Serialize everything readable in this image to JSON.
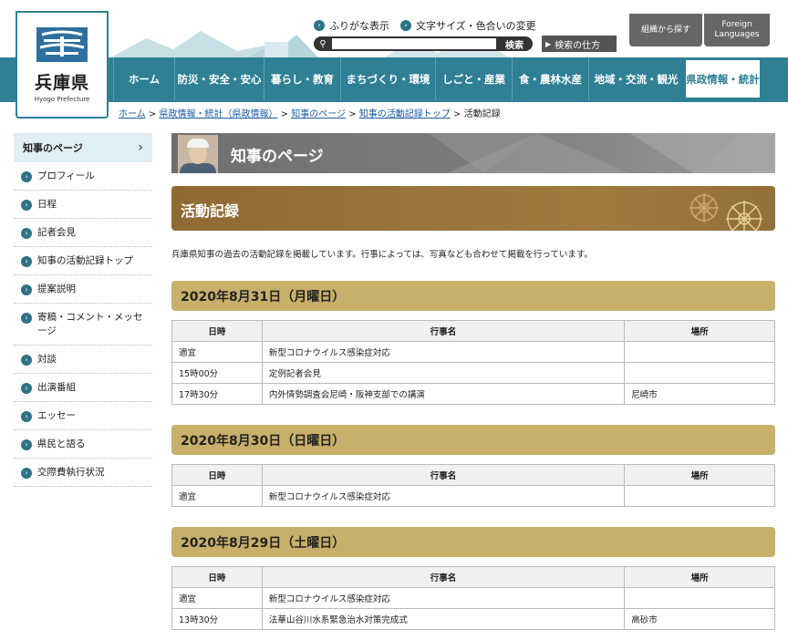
{
  "header": {
    "logo_title": "兵庫県",
    "logo_sub": "Hyogo Prefecture",
    "util_links": [
      "ふりがな表示",
      "文字サイズ・色合いの変更"
    ],
    "search": {
      "placeholder": "",
      "button": "検索"
    },
    "howto": "検索の仕方",
    "org_search": "組織から探す",
    "foreign": "Foreign Languages"
  },
  "nav": {
    "items": [
      "ホーム",
      "防災・安全・安心",
      "暮らし・教育",
      "まちづくり・環境",
      "しごと・産業",
      "食・農林水産",
      "地域・交流・観光",
      "県政情報・統計"
    ],
    "active_index": 7
  },
  "breadcrumb": [
    "ホーム",
    "県政情報・統計（県政情報）",
    "知事のページ",
    "知事の活動記録トップ",
    "活動記録"
  ],
  "sidebar": {
    "title": "知事のページ",
    "items": [
      "プロフィール",
      "日程",
      "記者会見",
      "知事の活動記録トップ",
      "提案説明",
      "寄稿・コメント・メッセージ",
      "対談",
      "出演番組",
      "エッセー",
      "県民と語る",
      "交際費執行状況"
    ]
  },
  "main": {
    "banner": "知事のページ",
    "title": "活動記録",
    "intro": "兵庫県知事の過去の活動記録を掲載しています。行事によっては、写真なども合わせて掲載を行っています。",
    "columns": [
      "日時",
      "行事名",
      "場所"
    ],
    "days": [
      {
        "date": "2020年8月31日（月曜日）",
        "rows": [
          [
            "適宜",
            "新型コロナウイルス感染症対応",
            ""
          ],
          [
            "15時00分",
            "定例記者会見",
            ""
          ],
          [
            "17時30分",
            "内外情勢調査会尼崎・阪神支部での講演",
            "尼崎市"
          ]
        ]
      },
      {
        "date": "2020年8月30日（日曜日）",
        "rows": [
          [
            "適宜",
            "新型コロナウイルス感染症対応",
            ""
          ]
        ]
      },
      {
        "date": "2020年8月29日（土曜日）",
        "rows": [
          [
            "適宜",
            "新型コロナウイルス感染症対応",
            ""
          ],
          [
            "13時30分",
            "法華山谷川水系緊急治水対策完成式",
            "高砂市"
          ]
        ]
      }
    ]
  },
  "colors": {
    "teal": "#2f7f95",
    "brown": "#9a7339",
    "gold": "#c8b06a",
    "link": "#1a5aa6"
  }
}
